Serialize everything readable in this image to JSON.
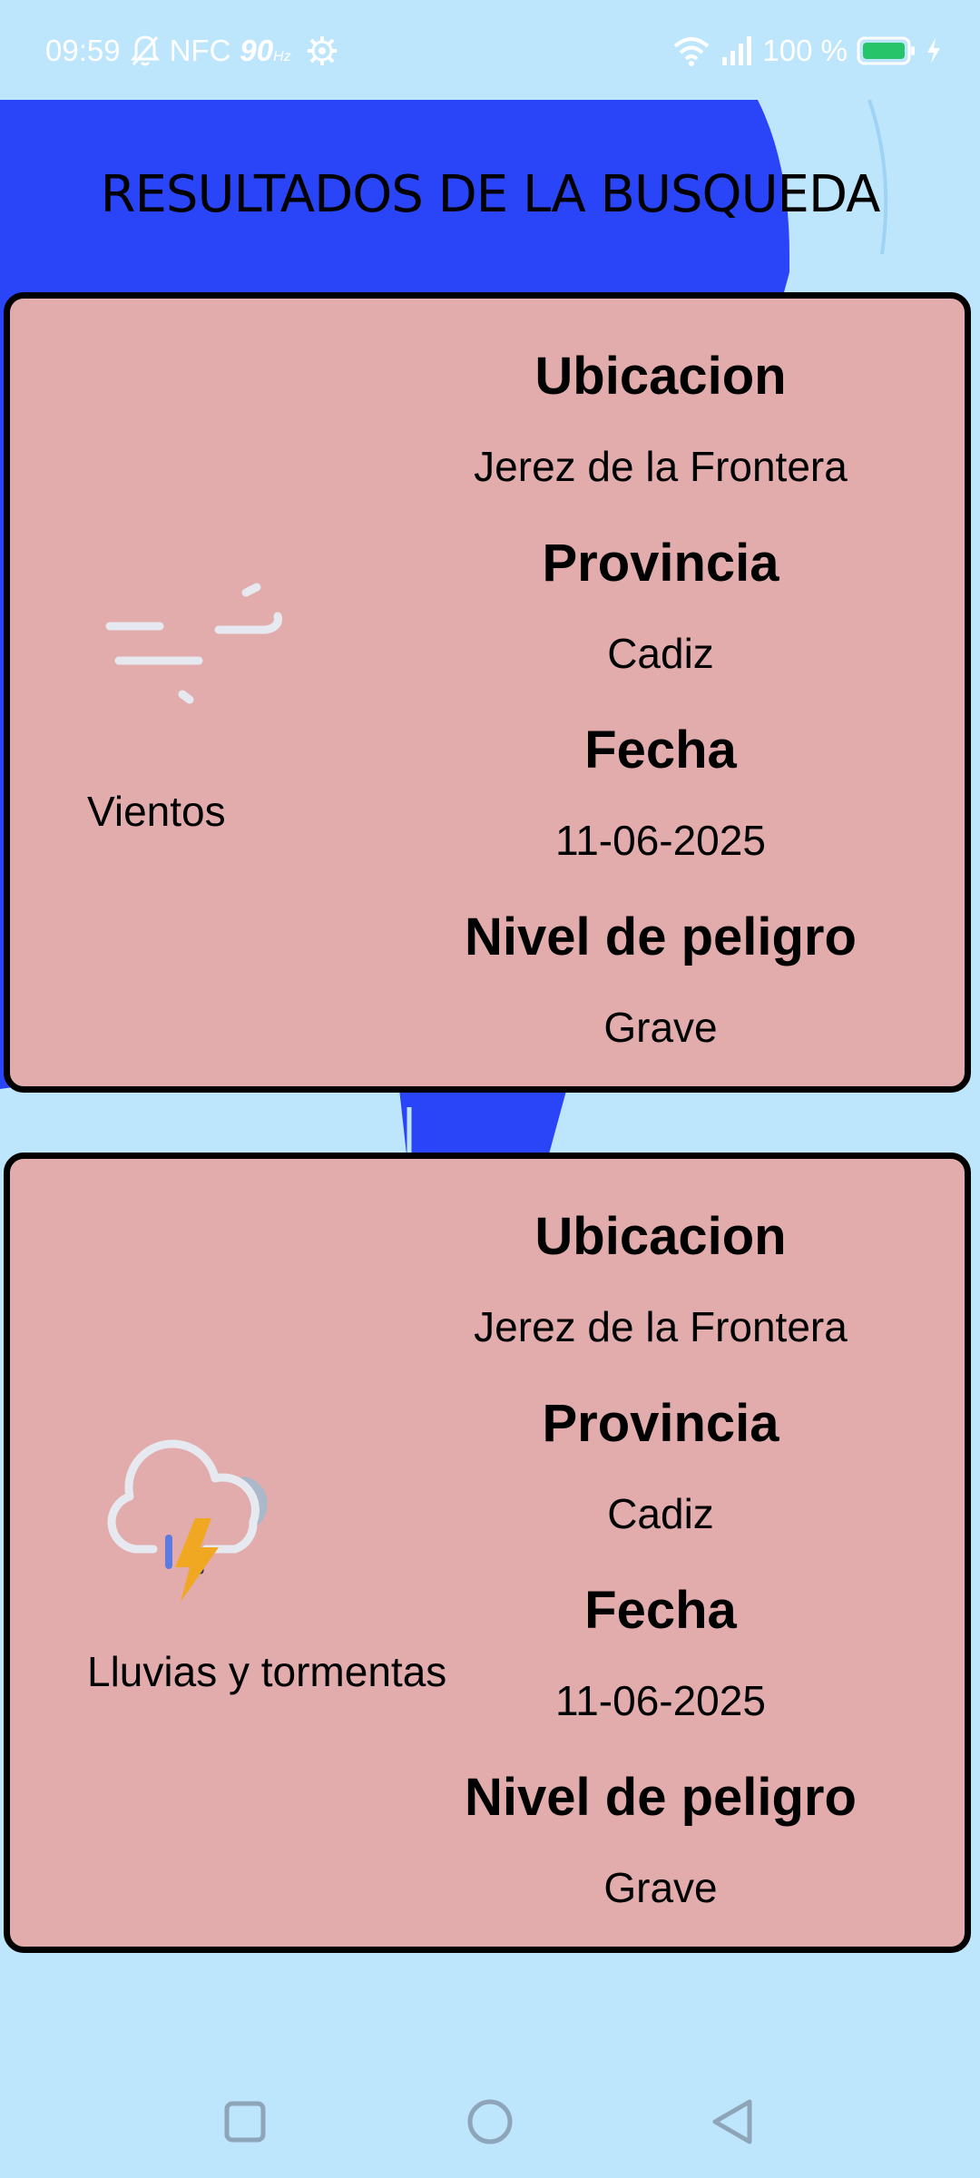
{
  "status_bar": {
    "time": "09:59",
    "nfc": "NFC",
    "refresh_rate": "90",
    "refresh_unit": "Hz",
    "battery": "100 %",
    "icons": [
      "mute-icon",
      "settings-icon",
      "wifi-icon",
      "signal-icon",
      "battery-icon",
      "charging-icon"
    ]
  },
  "header": {
    "title": "RESULTADOS DE LA BUSQUEDA"
  },
  "labels": {
    "location": "Ubicacion",
    "province": "Provincia",
    "date": "Fecha",
    "danger": "Nivel de peligro"
  },
  "results": [
    {
      "icon": "wind-icon",
      "type": "Vientos",
      "location": "Jerez de la Frontera",
      "province": "Cadiz",
      "date": "11-06-2025",
      "danger": "Grave"
    },
    {
      "icon": "thunderstorm-icon",
      "type": "Lluvias y tormentas",
      "location": "Jerez de la Frontera",
      "province": "Cadiz",
      "date": "11-06-2025",
      "danger": "Grave"
    }
  ],
  "navigation": {
    "buttons": [
      "recents-button",
      "home-button",
      "back-button"
    ]
  },
  "colors": {
    "background": "#bde6fd",
    "accent_blue": "#2a45f7",
    "card": "#e3acac",
    "card_border": "#000000",
    "status_text": "#ffffff"
  }
}
